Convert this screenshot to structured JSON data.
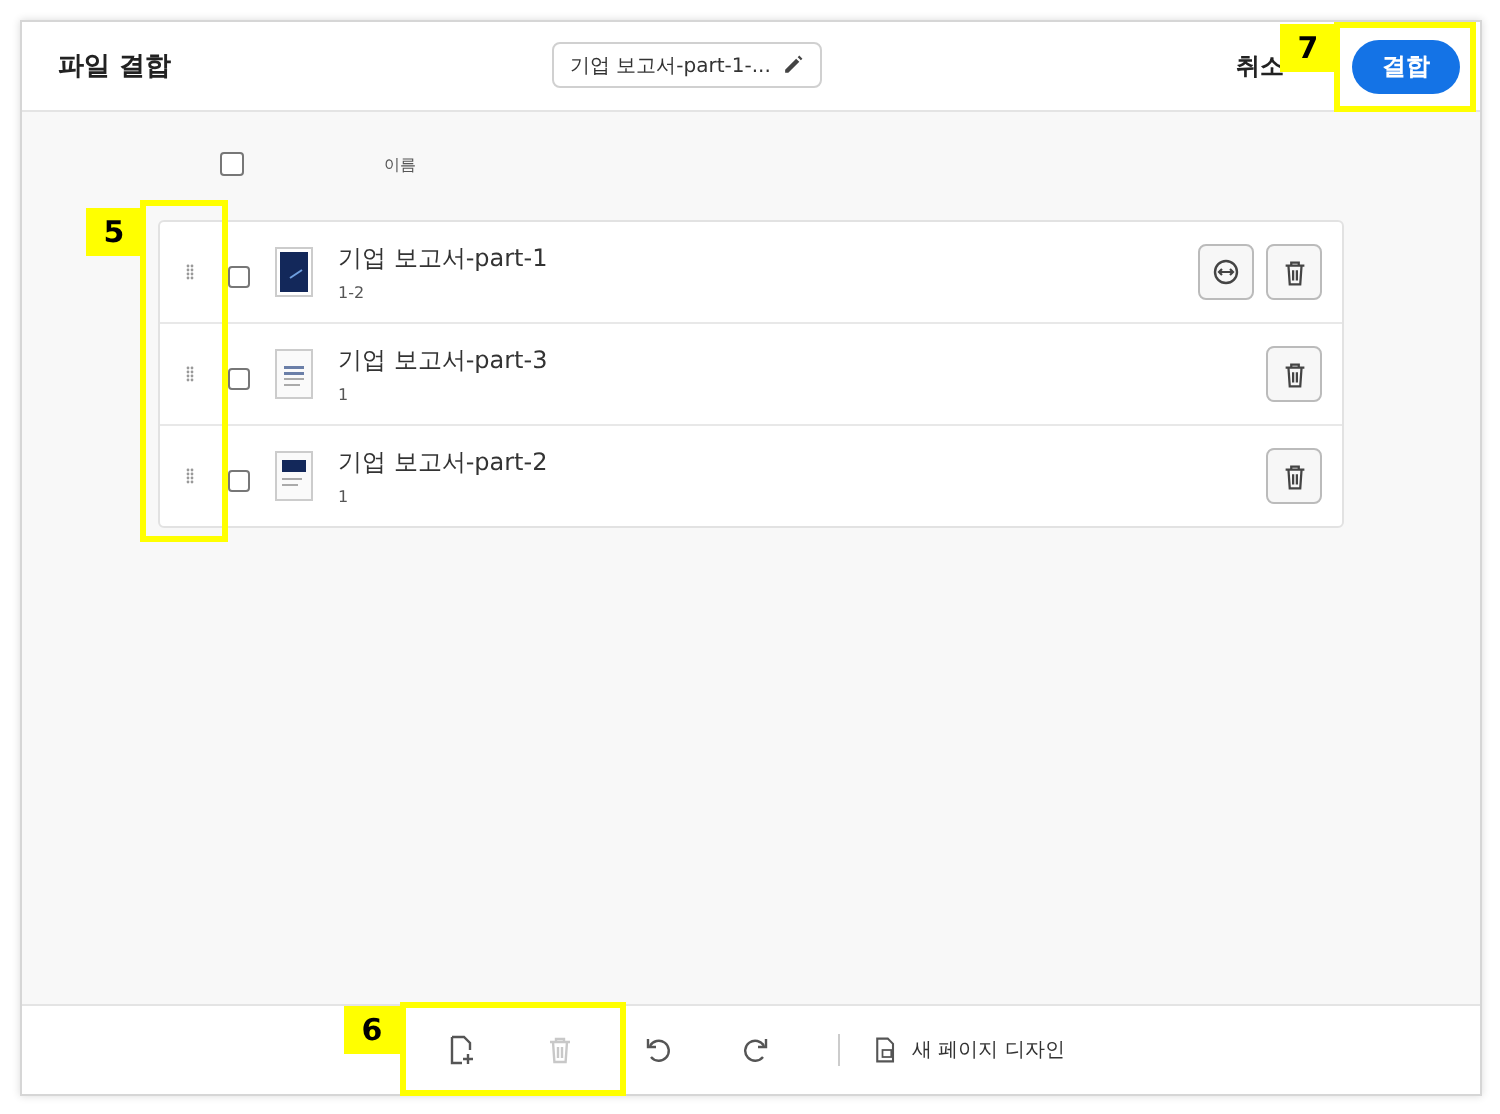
{
  "header": {
    "title": "파일 결합",
    "filename": "기업 보고서-part-1-...",
    "cancel": "취소",
    "combine": "결합"
  },
  "list_header": {
    "select_all_checked": false,
    "column": "이름"
  },
  "files": [
    {
      "name": "기업 보고서-part-1",
      "pages": "1-2",
      "checked": false,
      "expandable": true,
      "kind": "cover"
    },
    {
      "name": "기업 보고서-part-3",
      "pages": "1",
      "checked": false,
      "expandable": false,
      "kind": "text"
    },
    {
      "name": "기업 보고서-part-2",
      "pages": "1",
      "checked": false,
      "expandable": false,
      "kind": "banner"
    }
  ],
  "toolbar": {
    "tools": [
      {
        "kind": "add",
        "disabled": false
      },
      {
        "kind": "delete",
        "disabled": true
      },
      {
        "kind": "undo",
        "disabled": false
      },
      {
        "kind": "redo",
        "disabled": false
      }
    ],
    "design_label": "새 페이지 디자인"
  },
  "callouts": [
    {
      "label": "5"
    },
    {
      "label": "6"
    },
    {
      "label": "7"
    }
  ]
}
